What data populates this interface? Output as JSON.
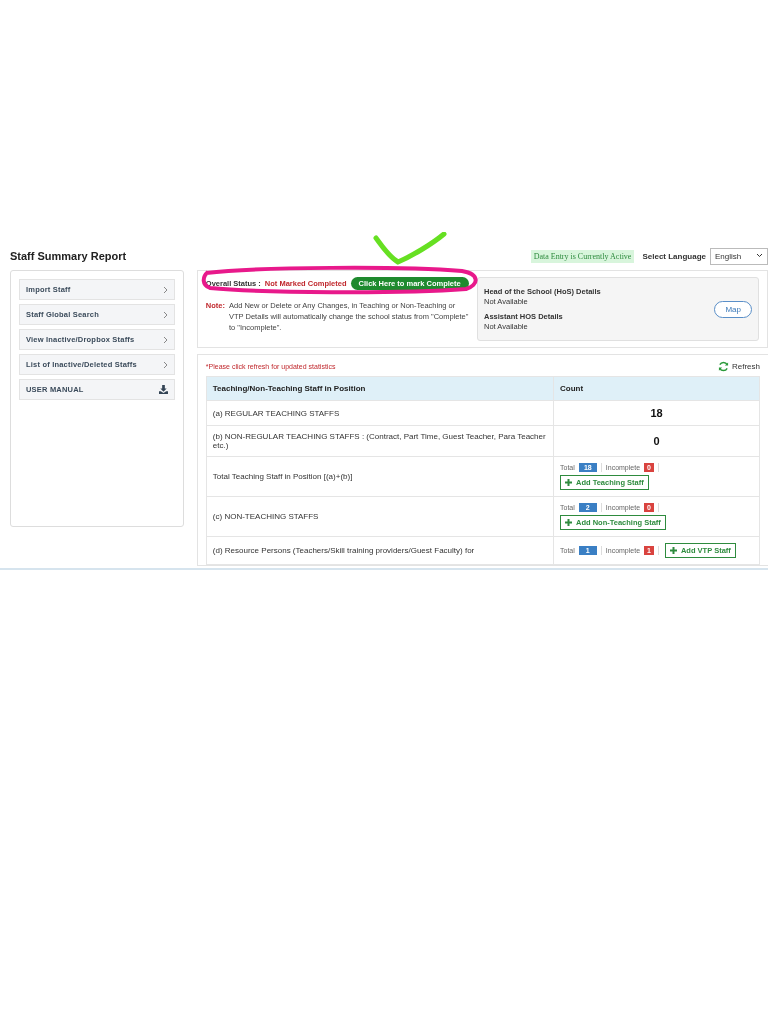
{
  "page_title": "Staff Summary Report",
  "data_entry_status": "Data Entry is Currently Active",
  "language": {
    "label": "Select Language",
    "value": "English"
  },
  "sidebar": {
    "items": [
      {
        "label": "Import Staff",
        "kind": "link"
      },
      {
        "label": "Staff Global Search",
        "kind": "link"
      },
      {
        "label": "View Inactive/Dropbox Staffs",
        "kind": "link"
      },
      {
        "label": "List of Inactive/Deleted Staffs",
        "kind": "link"
      },
      {
        "label": "USER MANUAL",
        "kind": "download"
      }
    ]
  },
  "status": {
    "label": "Overall Status :",
    "value": "Not Marked Completed",
    "button": "Click Here to mark Complete"
  },
  "note": {
    "label": "Note:",
    "text": "Add New or Delete or Any Changes, in Teaching or Non-Teaching or VTP Details will automatically change the school status from \"Complete\" to \"Incomplete\"."
  },
  "hos": {
    "title": "Head of the School (HoS) Details",
    "value": "Not Available",
    "button": "Map",
    "assistant_title": "Assistant HOS Details",
    "assistant_value": "Not Available"
  },
  "refresh_hint": "*Please click refresh for updated statistics",
  "refresh_button": "Refresh",
  "table": {
    "columns": [
      "Teaching/Non-Teaching Staff in Position",
      "Count"
    ],
    "rows": [
      {
        "kind": "count",
        "label": "(a) REGULAR TEACHING STAFFS",
        "count": "18"
      },
      {
        "kind": "count",
        "label": "(b) NON-REGULAR TEACHING STAFFS : (Contract, Part Time, Guest Teacher, Para Teacher etc.)",
        "count": "0"
      },
      {
        "kind": "summary",
        "label": "Total Teaching Staff in Position [(a)+(b)]",
        "total_label": "Total",
        "total": "18",
        "incomplete_label": "Incomplete",
        "incomplete": "0",
        "button": "Add Teaching Staff"
      },
      {
        "kind": "summary",
        "label": "(c) NON-TEACHING STAFFS",
        "total_label": "Total",
        "total": "2",
        "incomplete_label": "Incomplete",
        "incomplete": "0",
        "button": "Add Non-Teaching Staff"
      },
      {
        "kind": "inline",
        "label": "(d) Resource Persons (Teachers/Skill training providers/Guest Faculty) for",
        "total_label": "Total",
        "total": "1",
        "incomplete_label": "Incomplete",
        "incomplete": "1",
        "button": "Add VTP Staff"
      }
    ]
  }
}
